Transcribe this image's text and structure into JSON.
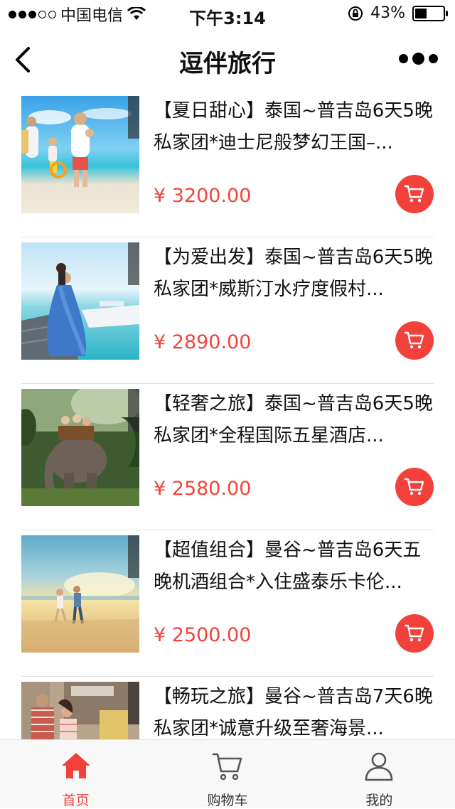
{
  "status_bar": {
    "carrier": "中国电信",
    "time": "下午3:14",
    "battery": "43%",
    "battery_level": 0.43,
    "signal_bars": 3
  },
  "nav": {
    "title": "逗伴旅行",
    "back_icon": "chevron-left-icon",
    "more_icon": "more-dots-icon"
  },
  "products": [
    {
      "title": "【夏日甜心】泰国~普吉岛6天5晚私家团*迪士尼般梦幻王国–...",
      "price": "¥ 3200.00",
      "image": "beach-family"
    },
    {
      "title": "【为爱出发】泰国~普吉岛6天5晚私家团*威斯汀水疗度假村...",
      "price": "¥ 2890.00",
      "image": "wedding-pier"
    },
    {
      "title": "【轻奢之旅】泰国~普吉岛6天5晚私家团*全程国际五星酒店...",
      "price": "¥ 2580.00",
      "image": "elephant-ride"
    },
    {
      "title": "【超值组合】曼谷~普吉岛6天五晚机酒组合*入住盛泰乐卡伦...",
      "price": "¥ 2500.00",
      "image": "sunset-couple"
    },
    {
      "title": "【畅玩之旅】曼谷~普吉岛7天6晚私家团*诚意升级至奢海景...",
      "price": "¥ ",
      "image": "street-couple"
    }
  ],
  "tabbar": {
    "tabs": [
      {
        "label": "首页",
        "icon": "home-icon",
        "active": true
      },
      {
        "label": "购物车",
        "icon": "cart-icon",
        "active": false
      },
      {
        "label": "我的",
        "icon": "user-icon",
        "active": false
      }
    ]
  },
  "colors": {
    "accent": "#f2403a",
    "price": "#f0443b"
  }
}
